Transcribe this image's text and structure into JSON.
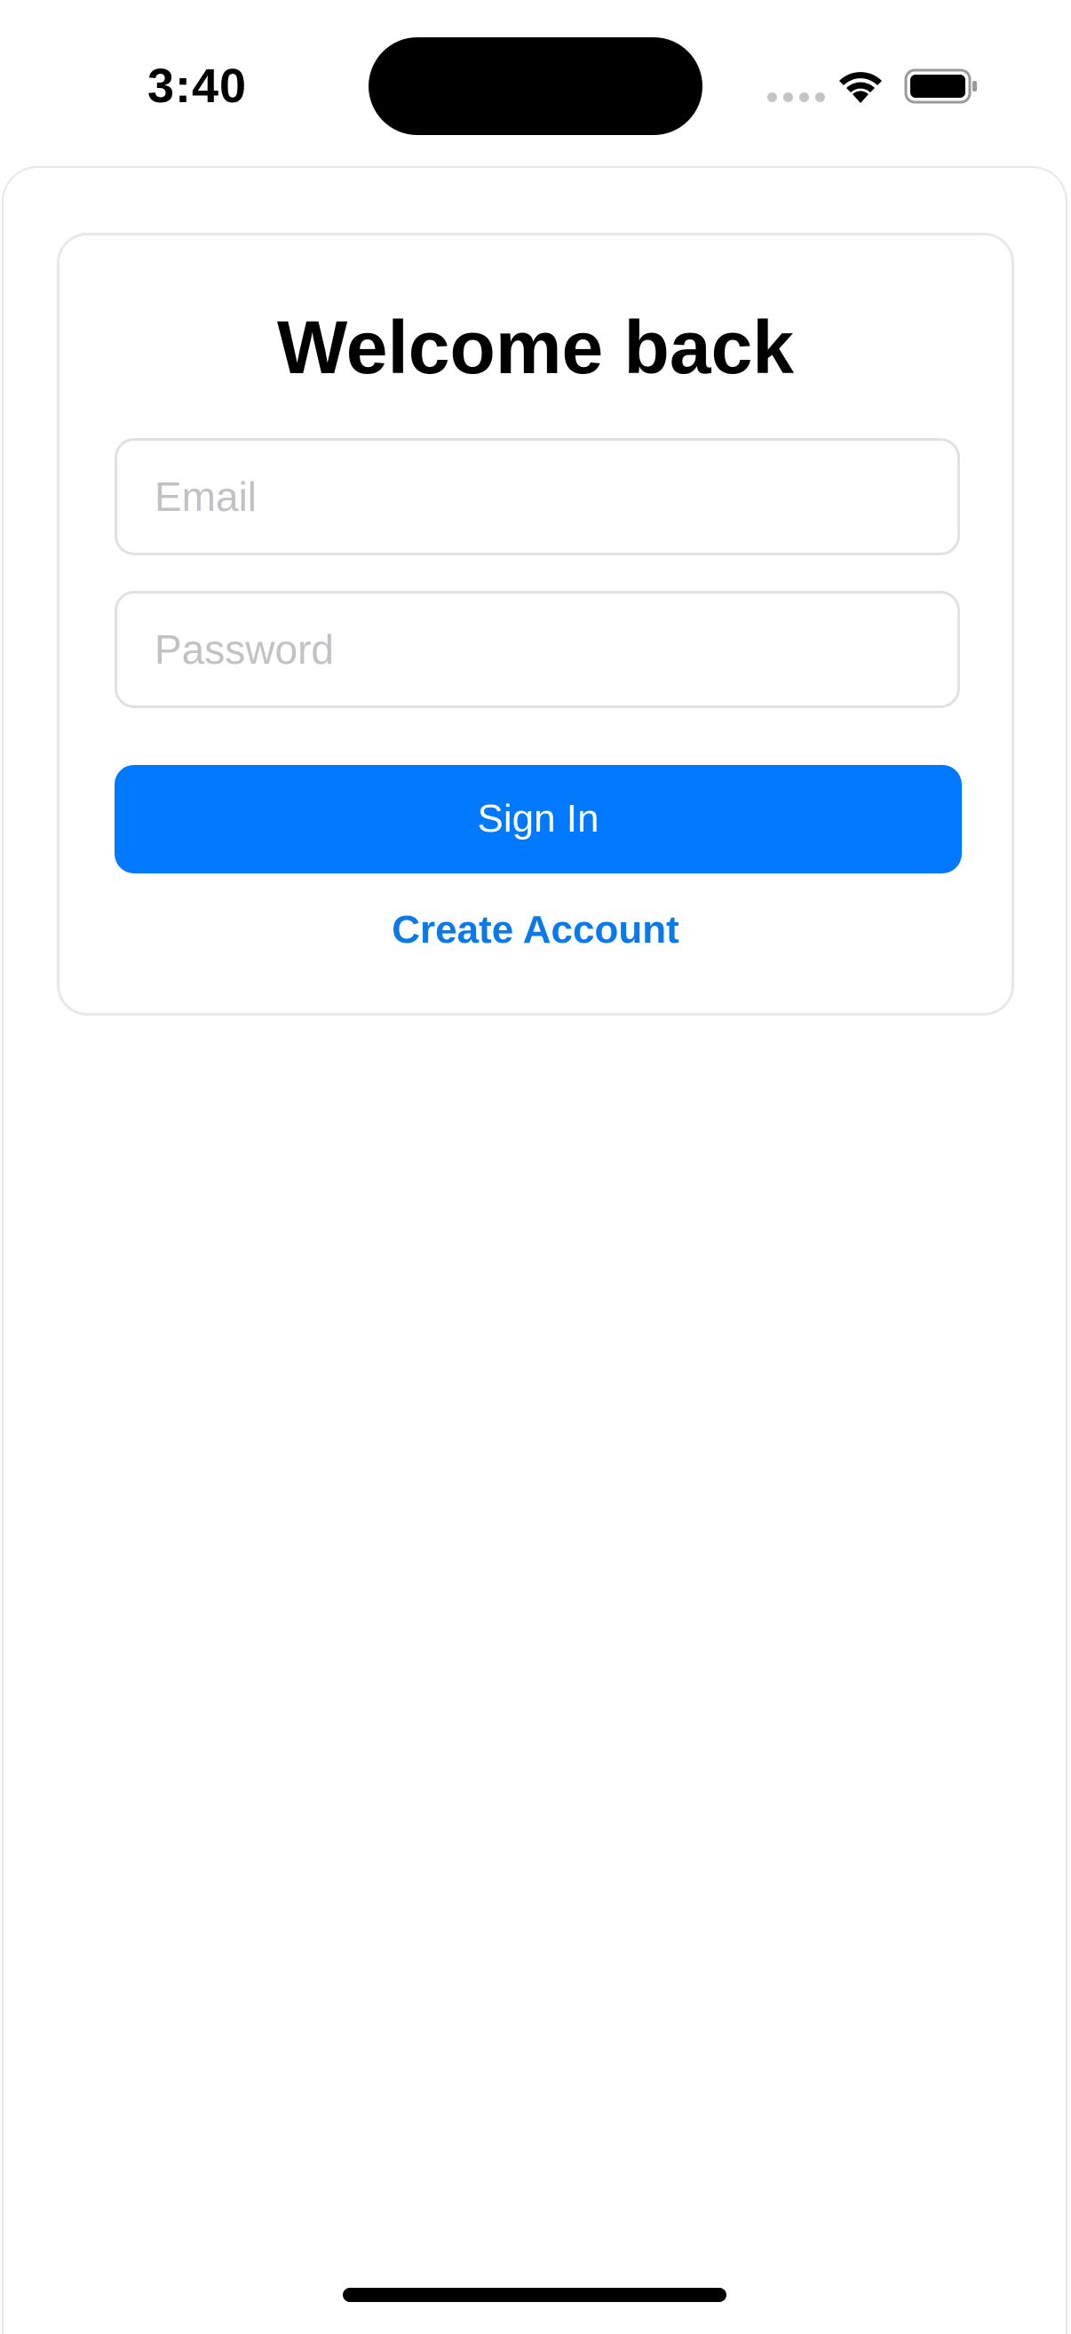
{
  "status_bar": {
    "time": "3:40",
    "icons": [
      "signal-dots-icon",
      "wifi-icon",
      "battery-icon"
    ]
  },
  "login": {
    "title": "Welcome back",
    "email_placeholder": "Email",
    "email_value": "",
    "password_placeholder": "Password",
    "password_value": "",
    "sign_in_label": "Sign In",
    "create_account_label": "Create Account"
  },
  "colors": {
    "accent": "#0179fe",
    "link": "#0a7aea",
    "border": "#e1e1e1",
    "placeholder": "#c2c2c6"
  }
}
